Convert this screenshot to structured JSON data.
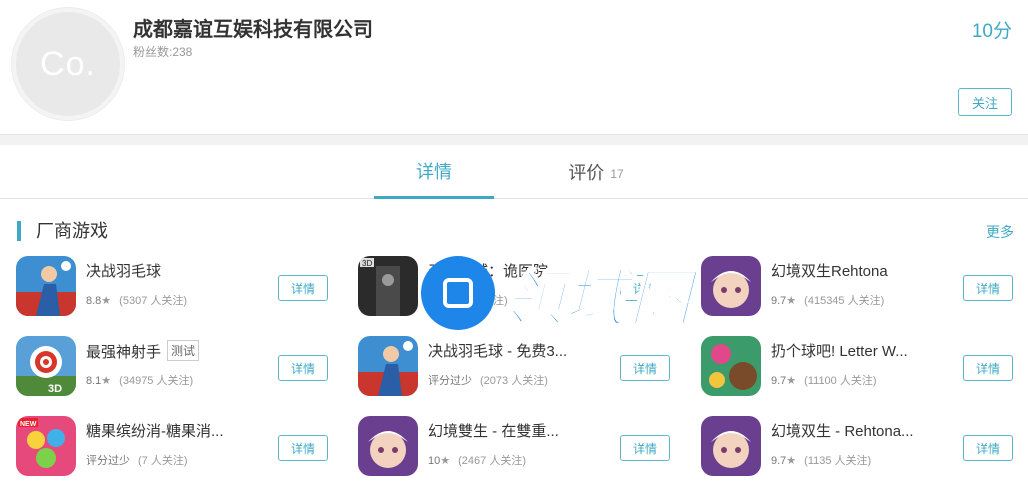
{
  "header": {
    "logo_text": "Co.",
    "company_name": "成都嘉谊互娱科技有限公司",
    "fans": "粉丝数:238",
    "score": "10分",
    "follow_label": "关注"
  },
  "tabs": [
    {
      "label": "详情",
      "active": true
    },
    {
      "label": "评价",
      "count": "17"
    }
  ],
  "section": {
    "title": "厂商游戏",
    "more": "更多"
  },
  "watermark": {
    "text": "领域圈"
  },
  "games": [
    {
      "name": "决战羽毛球",
      "tag": "",
      "rating": "8.8",
      "followers": "(5307 人关注)",
      "button": "详情",
      "icon": "badminton-game-icon"
    },
    {
      "name": "天使之城：诡医院",
      "tag": "",
      "rating": "1",
      "followers": "(13 人关注)",
      "button": "详情",
      "icon": "horror-game-icon"
    },
    {
      "name": "幻境双生Rehtona",
      "tag": "",
      "rating": "9.7",
      "followers": "(415345 人关注)",
      "button": "详情",
      "icon": "rehtona-game-icon"
    },
    {
      "name": "最强神射手",
      "tag": "测试",
      "rating": "8.1",
      "followers": "(34975 人关注)",
      "button": "详情",
      "icon": "archery-game-icon"
    },
    {
      "name": "决战羽毛球 - 免费3...",
      "tag": "",
      "rating": "评分过少",
      "followers": "(2073 人关注)",
      "button": "详情",
      "icon": "badminton-game-icon"
    },
    {
      "name": "扔个球吧! Letter W...",
      "tag": "",
      "rating": "9.7",
      "followers": "(11100 人关注)",
      "button": "详情",
      "icon": "ball-game-icon"
    },
    {
      "name": "糖果缤纷消-糖果消...",
      "tag": "",
      "rating": "评分过少",
      "followers": "(7 人关注)",
      "button": "详情",
      "icon": "candy-game-icon"
    },
    {
      "name": "幻境雙生 - 在雙重...",
      "tag": "",
      "rating": "10",
      "followers": "(2467 人关注)",
      "button": "详情",
      "icon": "rehtona-game-icon"
    },
    {
      "name": "幻境双生 - Rehtona...",
      "tag": "",
      "rating": "9.7",
      "followers": "(1135 人关注)",
      "button": "详情",
      "icon": "rehtona-game-icon"
    }
  ]
}
